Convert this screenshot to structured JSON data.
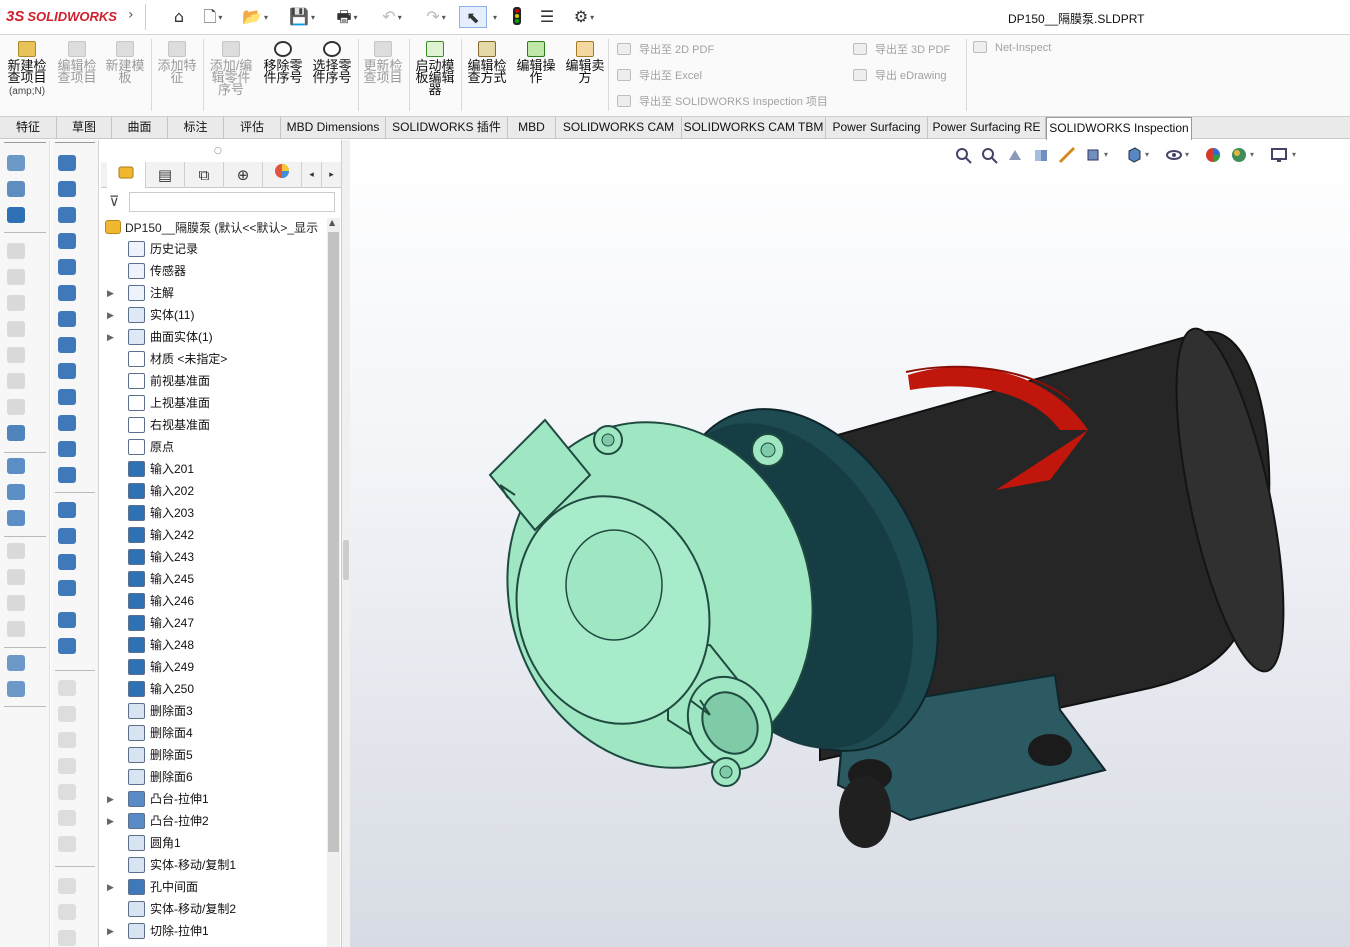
{
  "app": {
    "logo_text": "SOLIDWORKS",
    "logo_prefix": "3S",
    "file_title": "DP150__隔膜泵.SLDPRT"
  },
  "quick_access": {
    "icons": [
      "home-icon",
      "new-document-icon",
      "open-folder-icon",
      "save-icon",
      "print-icon",
      "undo-icon",
      "redo-icon",
      "select-cursor-icon",
      "rebuild-light-icon",
      "file-properties-icon",
      "options-gear-icon"
    ]
  },
  "ribbon": {
    "buttons": [
      {
        "label": "新建检\n查项目",
        "sub": "(amp;N)",
        "enabled": true
      },
      {
        "label": "编辑检\n查项目",
        "enabled": false
      },
      {
        "label": "新建模\n板",
        "enabled": false
      },
      {
        "label": "添加特\n征",
        "enabled": false
      },
      {
        "label": "添加/编\n辑零件\n序号",
        "enabled": false
      },
      {
        "label": "移除零\n件序号",
        "enabled": true
      },
      {
        "label": "选择零\n件序号",
        "enabled": true
      },
      {
        "label": "更新检\n查项目",
        "enabled": false
      },
      {
        "label": "启动模\n板编辑\n器",
        "enabled": true
      },
      {
        "label": "编辑检\n查方式",
        "enabled": true
      },
      {
        "label": "编辑操\n作",
        "enabled": true
      },
      {
        "label": "编辑卖\n方",
        "enabled": true
      }
    ],
    "export": {
      "pdf2d": "导出至 2D PDF",
      "excel": "导出至 Excel",
      "inspection": "导出至 SOLIDWORKS Inspection 项目",
      "pdf3d": "导出至 3D PDF",
      "edrawing": "导出 eDrawing",
      "net_inspect": "Net-Inspect"
    }
  },
  "tabs": [
    "特征",
    "草图",
    "曲面",
    "标注",
    "评估",
    "MBD Dimensions",
    "SOLIDWORKS 插件",
    "MBD",
    "SOLIDWORKS CAM",
    "SOLIDWORKS CAM TBM",
    "Power Surfacing",
    "Power Surfacing RE",
    "SOLIDWORKS Inspection"
  ],
  "active_tab": "SOLIDWORKS Inspection",
  "feature_manager": {
    "tab_icons": [
      "feature-manager-icon",
      "property-manager-icon",
      "configuration-manager-icon",
      "dimxpert-icon",
      "display-manager-icon"
    ],
    "root": "DP150__隔膜泵 (默认<<默认>_显示",
    "items": [
      {
        "label": "历史记录",
        "expand": false,
        "icon": "history-icon"
      },
      {
        "label": "传感器",
        "expand": false,
        "icon": "sensor-icon"
      },
      {
        "label": "注解",
        "expand": true,
        "icon": "annotation-icon"
      },
      {
        "label": "实体(11)",
        "expand": true,
        "icon": "solid-bodies-icon"
      },
      {
        "label": "曲面实体(1)",
        "expand": true,
        "icon": "surface-bodies-icon"
      },
      {
        "label": "材质 <未指定>",
        "expand": false,
        "icon": "material-icon"
      },
      {
        "label": "前视基准面",
        "expand": false,
        "icon": "plane-icon"
      },
      {
        "label": "上视基准面",
        "expand": false,
        "icon": "plane-icon"
      },
      {
        "label": "右视基准面",
        "expand": false,
        "icon": "plane-icon"
      },
      {
        "label": "原点",
        "expand": false,
        "icon": "origin-icon"
      },
      {
        "label": "输入201",
        "expand": false,
        "icon": "imported-body-icon"
      },
      {
        "label": "输入202",
        "expand": false,
        "icon": "imported-body-icon"
      },
      {
        "label": "输入203",
        "expand": false,
        "icon": "imported-body-icon"
      },
      {
        "label": "输入242",
        "expand": false,
        "icon": "imported-body-icon"
      },
      {
        "label": "输入243",
        "expand": false,
        "icon": "imported-body-icon"
      },
      {
        "label": "输入245",
        "expand": false,
        "icon": "imported-body-icon"
      },
      {
        "label": "输入246",
        "expand": false,
        "icon": "imported-body-icon"
      },
      {
        "label": "输入247",
        "expand": false,
        "icon": "imported-body-icon"
      },
      {
        "label": "输入248",
        "expand": false,
        "icon": "imported-body-icon"
      },
      {
        "label": "输入249",
        "expand": false,
        "icon": "imported-body-icon"
      },
      {
        "label": "输入250",
        "expand": false,
        "icon": "imported-body-icon"
      },
      {
        "label": "删除面3",
        "expand": false,
        "icon": "delete-face-icon"
      },
      {
        "label": "删除面4",
        "expand": false,
        "icon": "delete-face-icon"
      },
      {
        "label": "删除面5",
        "expand": false,
        "icon": "delete-face-icon"
      },
      {
        "label": "删除面6",
        "expand": false,
        "icon": "delete-face-icon"
      },
      {
        "label": "凸台-拉伸1",
        "expand": true,
        "icon": "boss-extrude-icon"
      },
      {
        "label": "凸台-拉伸2",
        "expand": true,
        "icon": "boss-extrude-icon"
      },
      {
        "label": "圆角1",
        "expand": false,
        "icon": "fillet-icon"
      },
      {
        "label": "实体-移动/复制1",
        "expand": false,
        "icon": "move-copy-body-icon"
      },
      {
        "label": "孔中间面",
        "expand": true,
        "icon": "hole-midplane-icon"
      },
      {
        "label": "实体-移动/复制2",
        "expand": false,
        "icon": "move-copy-body-icon"
      },
      {
        "label": "切除-拉伸1",
        "expand": true,
        "icon": "cut-extrude-icon"
      }
    ]
  },
  "view_toolbar": {
    "icons": [
      "zoom-to-fit-icon",
      "zoom-to-area-icon",
      "previous-view-icon",
      "section-view-icon",
      "dynamic-annotation-icon",
      "view-orientation-icon",
      "display-style-icon",
      "hide-show-icon",
      "edit-appearance-icon",
      "apply-scene-icon",
      "view-settings-icon"
    ]
  },
  "model": {
    "name": "diaphragm-pump-model",
    "colors": {
      "pump_head": "#9fe6c3",
      "motor": "#262626",
      "ring": "#1e4a52",
      "arrow": "#c0160c",
      "bracket": "#2b5a63"
    }
  }
}
